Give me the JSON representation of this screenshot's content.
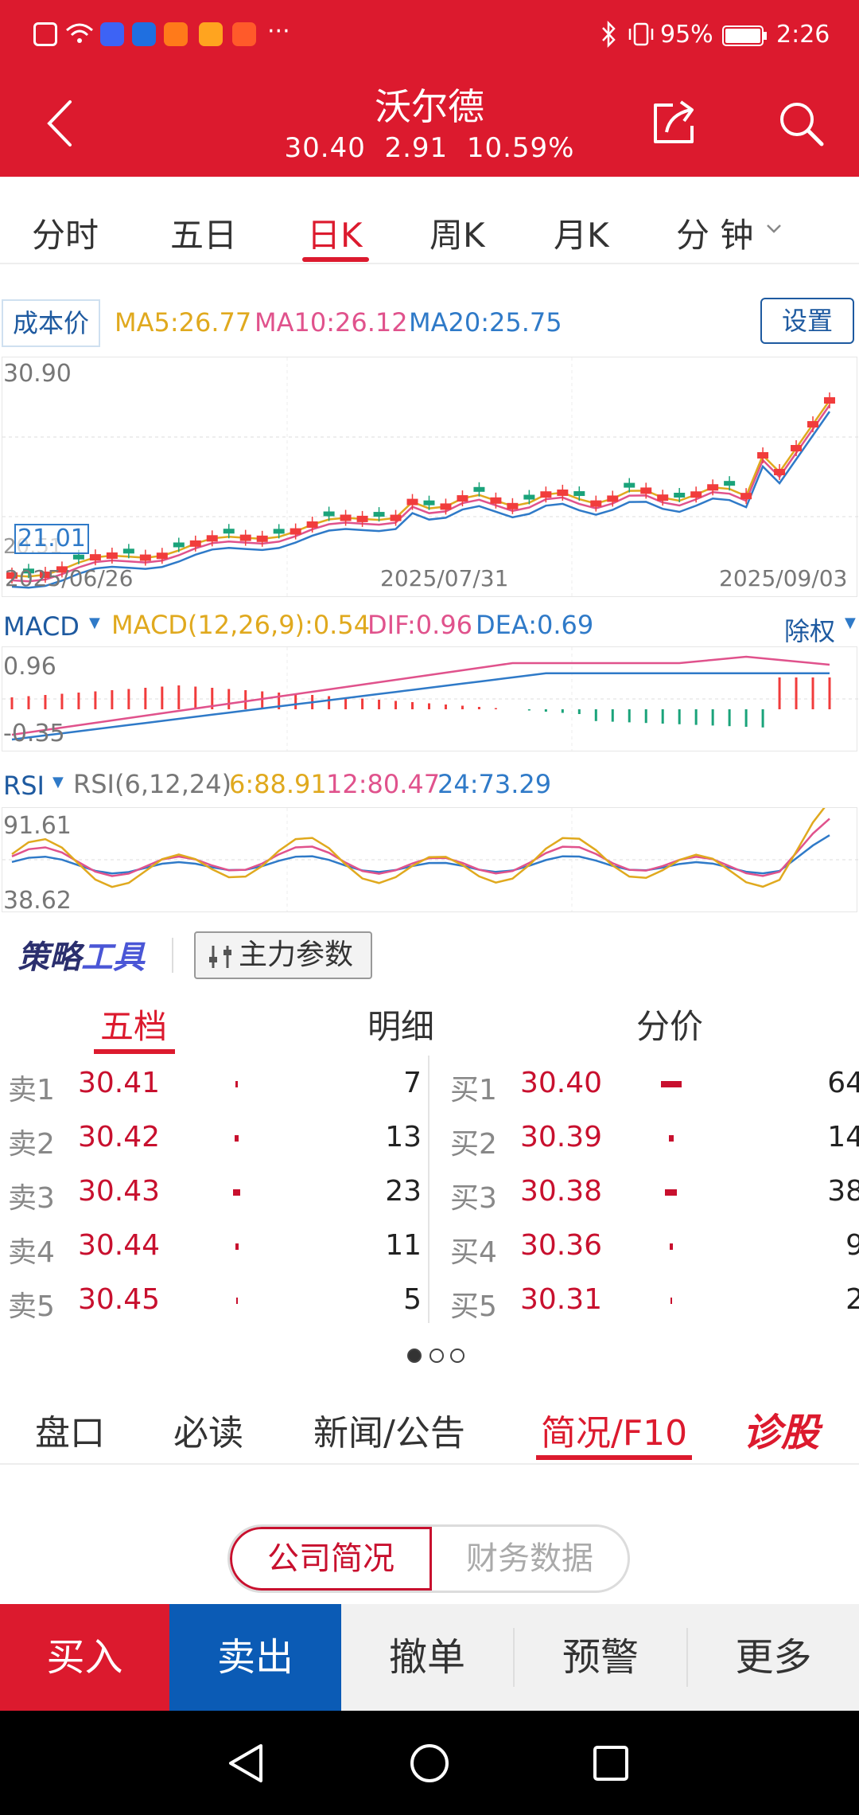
{
  "status_bar": {
    "battery": "95%",
    "time": "2:26",
    "more": "···"
  },
  "header": {
    "title": "沃尔德",
    "price": "30.40",
    "change": "2.91",
    "change_pct": "10.59%",
    "icons": [
      "back-icon",
      "share-icon",
      "search-icon"
    ]
  },
  "period_tabs": [
    {
      "label": "分时",
      "active": false
    },
    {
      "label": "五日",
      "active": false
    },
    {
      "label": "日K",
      "active": true
    },
    {
      "label": "周K",
      "active": false
    },
    {
      "label": "月K",
      "active": false
    },
    {
      "label": "分 钟",
      "active": false
    }
  ],
  "kline": {
    "cost_button": "成本价",
    "ma5": "MA5:26.77",
    "ma10": "MA10:26.12",
    "ma20": "MA20:25.75",
    "settings_button": "设置",
    "y_high": "30.90",
    "y_low": "21.01",
    "y_low_behind": "20.51",
    "dates": [
      "2025/06/26",
      "2025/07/31",
      "2025/09/03"
    ]
  },
  "macd": {
    "name": "MACD",
    "params": "MACD(12,26,9):0.54",
    "dif": "DIF:0.96",
    "dea": "DEA:0.69",
    "adjust": "除权",
    "y_high": "0.96",
    "y_low": "-0.35"
  },
  "rsi": {
    "name": "RSI",
    "params": "RSI(6,12,24)",
    "rsi6": "6:88.91",
    "rsi12": "12:80.47",
    "rsi24": "24:73.29",
    "y_high": "91.61",
    "y_low": "38.62"
  },
  "strategy": {
    "logo_a": "策略",
    "logo_b": "工具",
    "main_force_button": "主力参数"
  },
  "order_book": {
    "tabs": [
      {
        "label": "五档",
        "active": true
      },
      {
        "label": "明细",
        "active": false
      },
      {
        "label": "分价",
        "active": false
      }
    ],
    "sell": [
      {
        "label": "卖1",
        "price": "30.41",
        "volume": "7",
        "bar": 0.11
      },
      {
        "label": "卖2",
        "price": "30.42",
        "volume": "13",
        "bar": 0.2
      },
      {
        "label": "卖3",
        "price": "30.43",
        "volume": "23",
        "bar": 0.36
      },
      {
        "label": "卖4",
        "price": "30.44",
        "volume": "11",
        "bar": 0.17
      },
      {
        "label": "卖5",
        "price": "30.45",
        "volume": "5",
        "bar": 0.08
      }
    ],
    "buy": [
      {
        "label": "买1",
        "price": "30.40",
        "volume": "64",
        "bar": 1.0
      },
      {
        "label": "买2",
        "price": "30.39",
        "volume": "14",
        "bar": 0.22
      },
      {
        "label": "买3",
        "price": "30.38",
        "volume": "38",
        "bar": 0.59
      },
      {
        "label": "买4",
        "price": "30.36",
        "volume": "9",
        "bar": 0.14
      },
      {
        "label": "买5",
        "price": "30.31",
        "volume": "2",
        "bar": 0.03
      }
    ],
    "pages": 3,
    "current_page": 1
  },
  "bottom_tabs": [
    {
      "label": "盘口",
      "active": false
    },
    {
      "label": "必读",
      "active": false
    },
    {
      "label": "新闻/公告",
      "active": false
    },
    {
      "label": "简况/F10",
      "active": true
    }
  ],
  "diagnose": "诊股",
  "segment": {
    "left": "公司简况",
    "right": "财务数据"
  },
  "actions": {
    "buy": "买入",
    "sell": "卖出",
    "cancel": "撤单",
    "alert": "预警",
    "more": "更多"
  },
  "colors": {
    "brand_red": "#dc1a2e",
    "sell_blue": "#0b5bb5",
    "ma5": "#e0a91e",
    "ma10": "#e0528c",
    "ma20": "#2f7ac8",
    "rise": "#f13c3c",
    "fall": "#1aa37a"
  }
}
